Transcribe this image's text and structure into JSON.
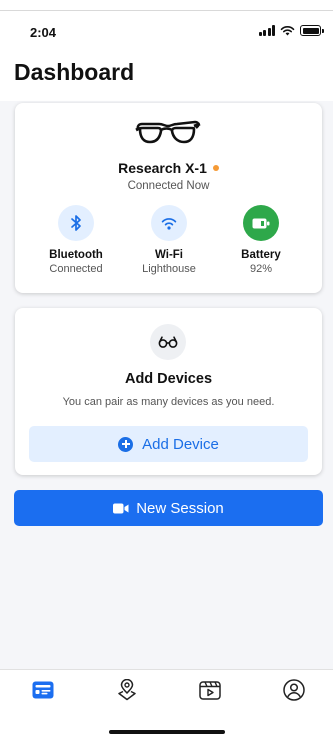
{
  "status_bar": {
    "time": "2:04"
  },
  "page": {
    "title": "Dashboard"
  },
  "device": {
    "name": "Research X-1",
    "status": "Connected Now",
    "status_dot_color": "#f59a35",
    "icon": "smart-glasses"
  },
  "features": [
    {
      "label": "Bluetooth",
      "value": "Connected",
      "icon": "bluetooth-icon"
    },
    {
      "label": "Wi-Fi",
      "value": "Lighthouse",
      "icon": "wifi-icon"
    },
    {
      "label": "Battery",
      "value": "92%",
      "icon": "battery-icon"
    }
  ],
  "add_devices": {
    "title": "Add Devices",
    "subtitle": "You can pair as many devices as you need.",
    "button_label": "Add Device",
    "icon": "glasses-icon"
  },
  "session": {
    "button_label": "New Session",
    "icon": "video-camera-icon"
  },
  "tabbar": {
    "items": [
      {
        "name": "dashboard",
        "icon": "dashboard-icon",
        "active": true
      },
      {
        "name": "location",
        "icon": "map-pin-icon",
        "active": false
      },
      {
        "name": "sessions",
        "icon": "video-library-icon",
        "active": false
      },
      {
        "name": "profile",
        "icon": "profile-icon",
        "active": false
      }
    ]
  },
  "colors": {
    "accent": "#1b6ef0",
    "accent_light": "#e3efff",
    "battery_green": "#2ea84a",
    "background": "#f5f6f9"
  }
}
